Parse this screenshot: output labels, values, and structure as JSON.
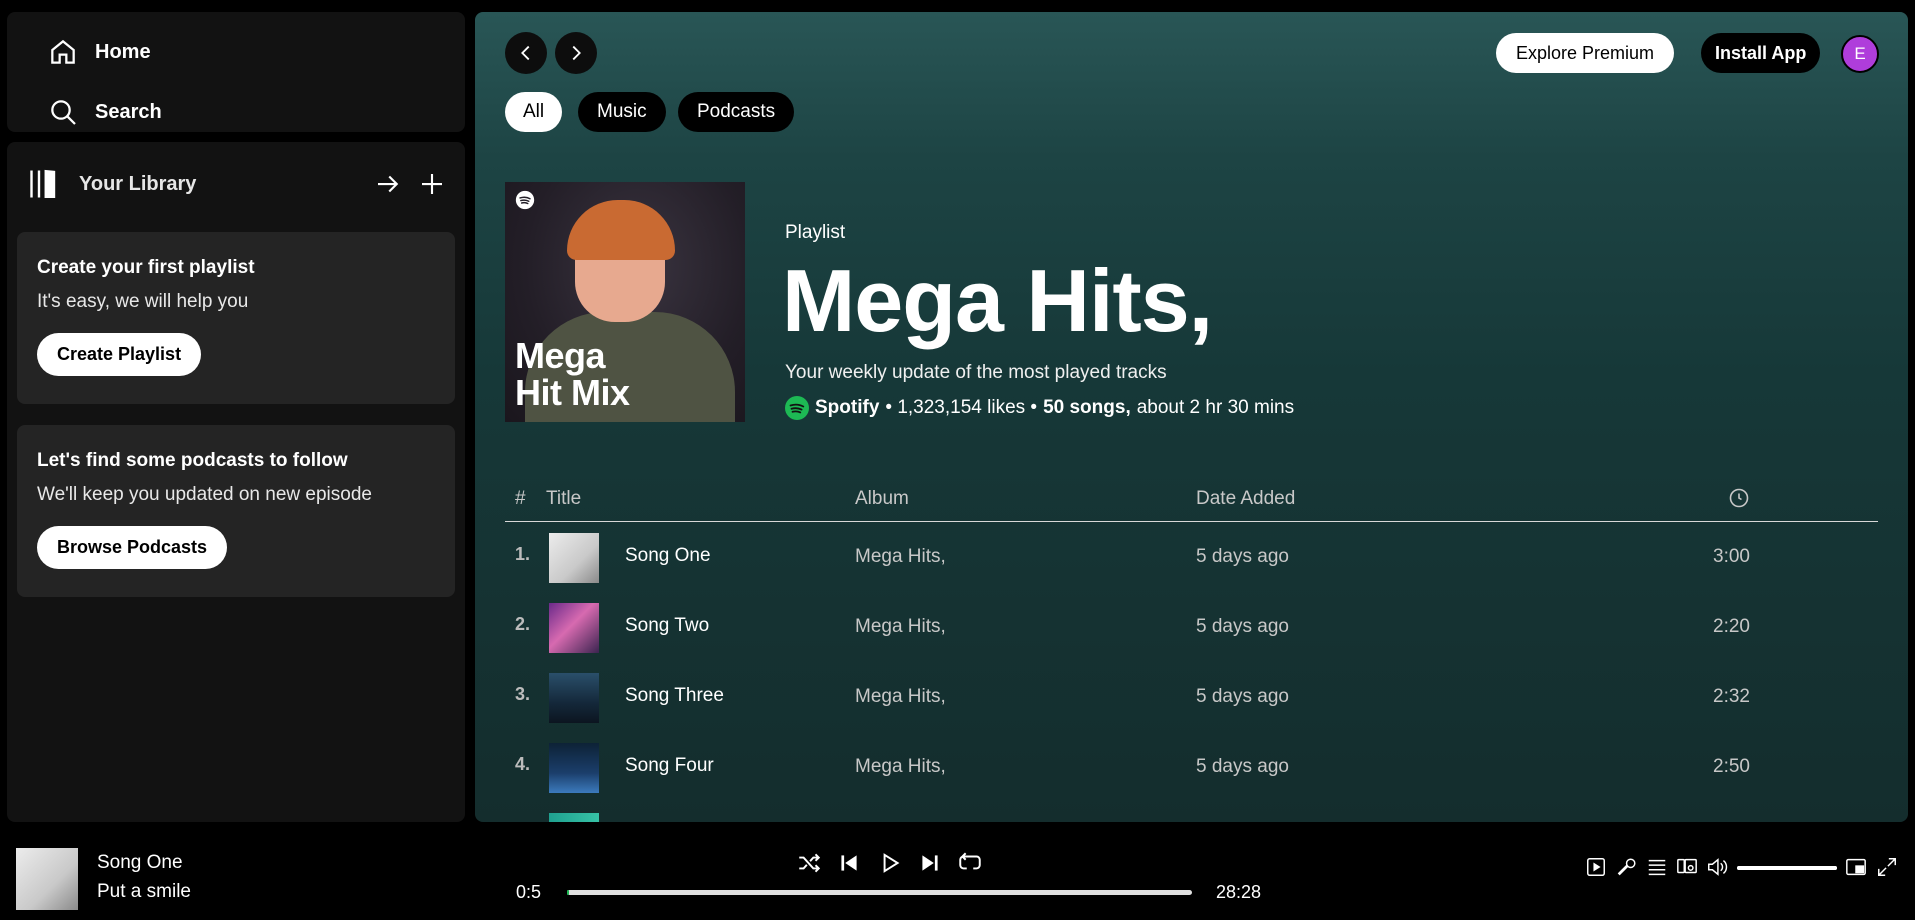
{
  "nav": {
    "home": "Home",
    "search": "Search"
  },
  "library": {
    "title": "Your Library",
    "cards": [
      {
        "title": "Create your first playlist",
        "sub": "It's easy, we will help you",
        "button": "Create Playlist"
      },
      {
        "title": "Let's find some podcasts to follow",
        "sub": "We'll keep you updated on new episode",
        "button": "Browse Podcasts"
      }
    ]
  },
  "topbar": {
    "explore": "Explore Premium",
    "install": "Install App",
    "avatar": "E"
  },
  "chips": [
    "All",
    "Music",
    "Podcasts"
  ],
  "playlist": {
    "cover_title": "Mega\nHit Mix",
    "type": "Playlist",
    "title": "Mega Hits,",
    "description": "Your weekly update of the most played tracks",
    "owner": "Spotify",
    "likes": "• 1,323,154 likes •",
    "songs": "50 songs,",
    "duration": "about 2 hr 30 mins"
  },
  "table": {
    "headers": {
      "num": "#",
      "title": "Title",
      "album": "Album",
      "date": "Date Added"
    },
    "rows": [
      {
        "num": "1.",
        "title": "Song One",
        "album": "Mega Hits,",
        "date": "5 days ago",
        "duration": "3:00"
      },
      {
        "num": "2.",
        "title": "Song Two",
        "album": "Mega Hits,",
        "date": "5 days ago",
        "duration": "2:20"
      },
      {
        "num": "3.",
        "title": "Song Three",
        "album": "Mega Hits,",
        "date": "5 days ago",
        "duration": "2:32"
      },
      {
        "num": "4.",
        "title": "Song Four",
        "album": "Mega Hits,",
        "date": "5 days ago",
        "duration": "2:50"
      }
    ]
  },
  "player": {
    "title": "Song One",
    "artist": "Put a smile",
    "current_time": "0:5",
    "total_time": "28:28",
    "progress": 0.003,
    "volume": 1.0
  },
  "colors": {
    "accent": "#1db954",
    "avatar": "#af3ddb",
    "main_bg": "#295656"
  },
  "icons": [
    "home-icon",
    "search-icon",
    "library-icon",
    "arrow-right-icon",
    "plus-icon",
    "chevron-left-icon",
    "chevron-right-icon",
    "clock-icon",
    "shuffle-icon",
    "previous-icon",
    "play-icon",
    "next-icon",
    "repeat-icon",
    "now-playing-view-icon",
    "lyrics-icon",
    "queue-icon",
    "connect-device-icon",
    "volume-icon",
    "miniplayer-icon",
    "fullscreen-icon"
  ]
}
